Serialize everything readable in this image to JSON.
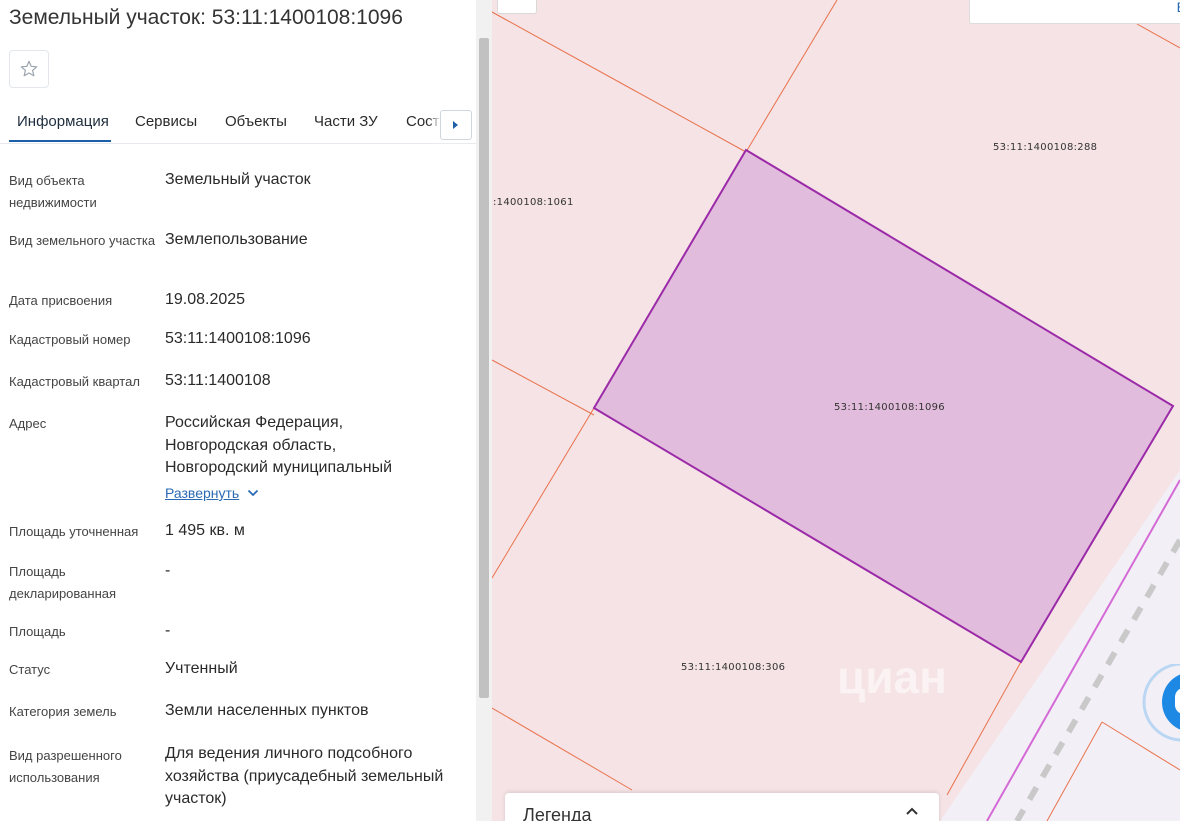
{
  "panel": {
    "title": "Земельный участок: 53:11:1400108:1096",
    "tabs": [
      {
        "label": "Информация"
      },
      {
        "label": "Сервисы"
      },
      {
        "label": "Объекты"
      },
      {
        "label": "Части ЗУ"
      },
      {
        "label": "Соста"
      }
    ],
    "rows": [
      {
        "label": "Вид объекта недвижимости",
        "value": "Земельный участок"
      },
      {
        "label": "Вид земельного участка",
        "value": "Землепользование"
      },
      {
        "label": "Дата присвоения",
        "value": "19.08.2025"
      },
      {
        "label": "Кадастровый номер",
        "value": "53:11:1400108:1096"
      },
      {
        "label": "Кадастровый квартал",
        "value": "53:11:1400108"
      },
      {
        "label": "Адрес",
        "value": "Российская Федерация, Новгородская область, Новгородский муниципальный"
      },
      {
        "label": "Площадь уточненная",
        "value": "1 495 кв. м"
      },
      {
        "label": "Площадь декларированная",
        "value": "-"
      },
      {
        "label": "Площадь",
        "value": "-"
      },
      {
        "label": "Статус",
        "value": "Учтенный"
      },
      {
        "label": "Категория земель",
        "value": "Земли населенных пунктов"
      },
      {
        "label": "Вид разрешенного использования",
        "value": "Для ведения личного подсобного хозяйства (приусадебный земельный участок)"
      }
    ],
    "expand_label": "Развернуть"
  },
  "map": {
    "parcel_labels": {
      "selected": "53:11:1400108:1096",
      "north": "53:11:1400108:288",
      "west": ":1400108:1061",
      "south": "53:11:1400108:306"
    },
    "search_hint": "В",
    "legend_title": "Легенда",
    "watermark": "циан",
    "colors": {
      "parcel_border": "#e9724c",
      "selected_fill": "#e2bcdc",
      "selected_border": "#9b2aa8",
      "map_bg": "#f5e3e5"
    }
  },
  "icons": {
    "favorite": "star-outline-icon",
    "tabs_next": "caret-right-icon",
    "expand": "chevron-down-icon",
    "legend_toggle": "chevron-up-icon",
    "chat": "chat-icon"
  }
}
